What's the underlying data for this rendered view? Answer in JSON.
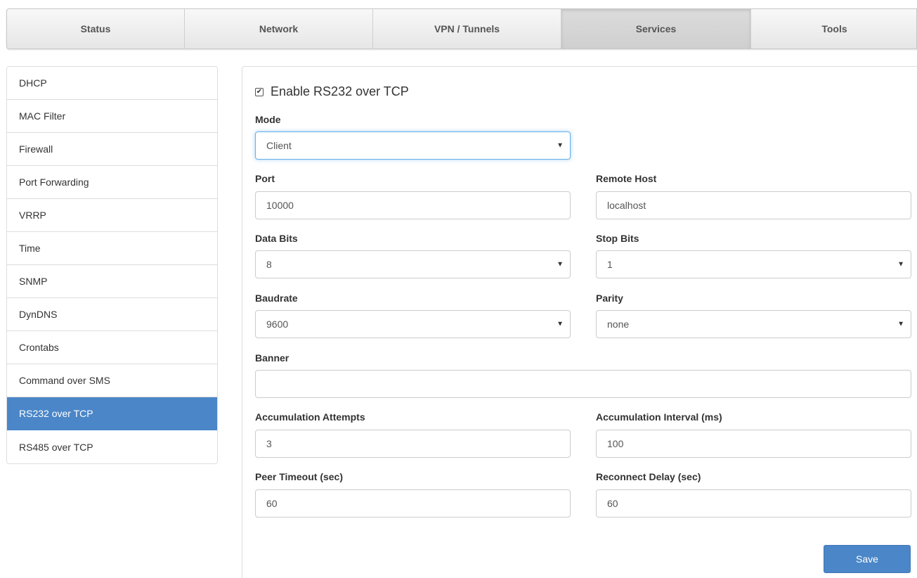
{
  "topnav": {
    "tabs": [
      {
        "label": "Status"
      },
      {
        "label": "Network"
      },
      {
        "label": "VPN / Tunnels"
      },
      {
        "label": "Services"
      },
      {
        "label": "Tools"
      }
    ],
    "active": "Services"
  },
  "sidebar": {
    "items": [
      {
        "label": "DHCP"
      },
      {
        "label": "MAC Filter"
      },
      {
        "label": "Firewall"
      },
      {
        "label": "Port Forwarding"
      },
      {
        "label": "VRRP"
      },
      {
        "label": "Time"
      },
      {
        "label": "SNMP"
      },
      {
        "label": "DynDNS"
      },
      {
        "label": "Crontabs"
      },
      {
        "label": "Command over SMS"
      },
      {
        "label": "RS232 over TCP"
      },
      {
        "label": "RS485 over TCP"
      }
    ],
    "active": "RS232 over TCP"
  },
  "form": {
    "enable": {
      "label": "Enable RS232 over TCP",
      "checked": true
    },
    "mode": {
      "label": "Mode",
      "value": "Client"
    },
    "port": {
      "label": "Port",
      "value": "10000"
    },
    "remote_host": {
      "label": "Remote Host",
      "value": "localhost"
    },
    "data_bits": {
      "label": "Data Bits",
      "value": "8"
    },
    "stop_bits": {
      "label": "Stop Bits",
      "value": "1"
    },
    "baudrate": {
      "label": "Baudrate",
      "value": "9600"
    },
    "parity": {
      "label": "Parity",
      "value": "none"
    },
    "banner": {
      "label": "Banner",
      "value": ""
    },
    "accumulation_attempts": {
      "label": "Accumulation Attempts",
      "value": "3"
    },
    "accumulation_interval": {
      "label": "Accumulation Interval (ms)",
      "value": "100"
    },
    "peer_timeout": {
      "label": "Peer Timeout (sec)",
      "value": "60"
    },
    "reconnect_delay": {
      "label": "Reconnect Delay (sec)",
      "value": "60"
    },
    "save_label": "Save"
  },
  "icons": {
    "checkbox": "checkmark-icon",
    "dropdown": "caret-down-icon"
  },
  "colors": {
    "accent": "#4a86c8",
    "focus_border": "#66afe9"
  }
}
